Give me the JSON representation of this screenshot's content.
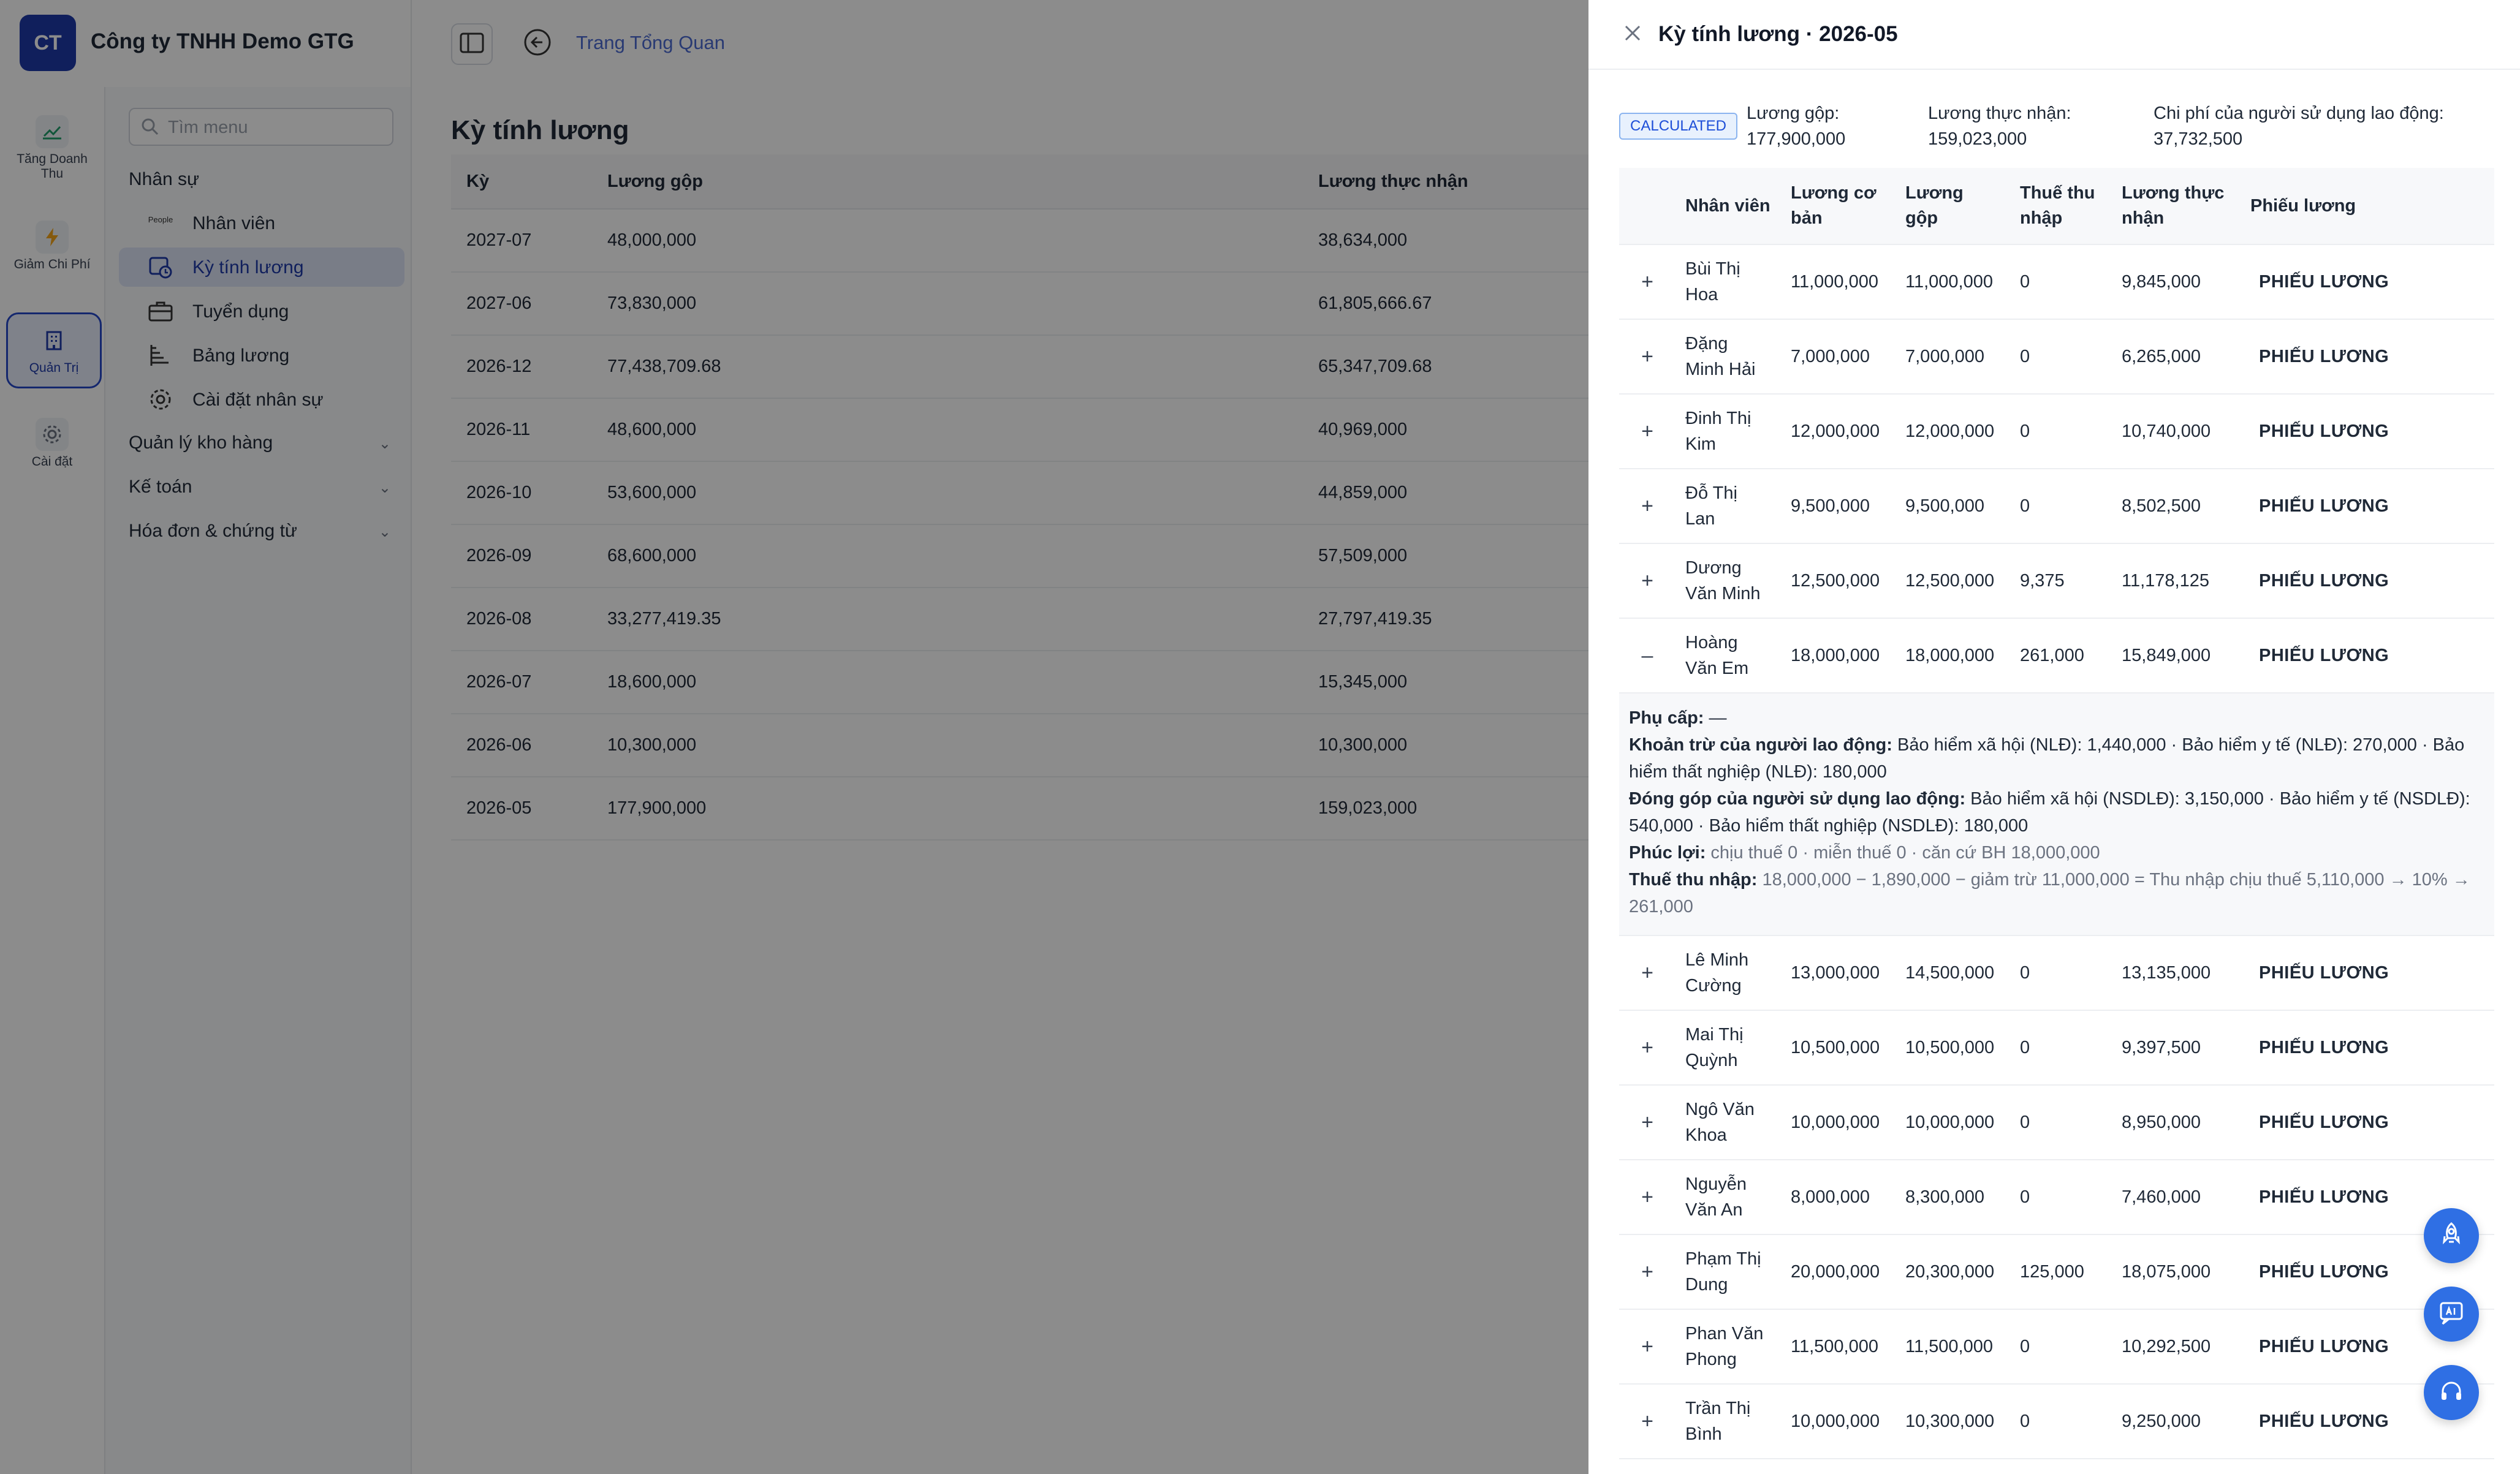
{
  "app": {
    "logo_text": "CT",
    "company_name": "Công ty TNHH Demo GTG",
    "breadcrumb": "Trang Tổng Quan"
  },
  "rail": [
    {
      "label": "Tăng Doanh Thu",
      "icon": "trending-up-icon"
    },
    {
      "label": "Giảm Chi Phí",
      "icon": "lightning-icon"
    },
    {
      "label": "Quản Trị",
      "icon": "building-icon"
    },
    {
      "label": "Cài đặt",
      "icon": "gear-icon"
    }
  ],
  "menu": {
    "search_placeholder": "Tìm menu",
    "group_hr": "Nhân sự",
    "items": [
      "Nhân viên",
      "Kỳ tính lương",
      "Tuyển dụng",
      "Bảng lương",
      "Cài đặt nhân sự"
    ],
    "people_tag": "People",
    "groups_collapsed": [
      "Quản lý kho hàng",
      "Kế toán",
      "Hóa đơn & chứng từ"
    ]
  },
  "page": {
    "title": "Kỳ tính lương",
    "columns": [
      "Kỳ",
      "Lương gộp",
      "Lương thực nhận"
    ],
    "rows": [
      [
        "2027-07",
        "48,000,000",
        "38,634,000"
      ],
      [
        "2027-06",
        "73,830,000",
        "61,805,666.67"
      ],
      [
        "2026-12",
        "77,438,709.68",
        "65,347,709.68"
      ],
      [
        "2026-11",
        "48,600,000",
        "40,969,000"
      ],
      [
        "2026-10",
        "53,600,000",
        "44,859,000"
      ],
      [
        "2026-09",
        "68,600,000",
        "57,509,000"
      ],
      [
        "2026-08",
        "33,277,419.35",
        "27,797,419.35"
      ],
      [
        "2026-07",
        "18,600,000",
        "15,345,000"
      ],
      [
        "2026-06",
        "10,300,000",
        "10,300,000"
      ],
      [
        "2026-05",
        "177,900,000",
        "159,023,000"
      ]
    ]
  },
  "drawer": {
    "title": "Kỳ tính lương · 2026-05",
    "status": "CALCULATED",
    "summary": {
      "gross_label": "Lương gộp:",
      "gross_value": "177,900,000",
      "net_label": "Lương thực nhận:",
      "net_value": "159,023,000",
      "employer_label": "Chi phí của người sử dụng lao động:",
      "employer_value": "37,732,500"
    },
    "columns": [
      "Nhân viên",
      "Lương cơ bản",
      "Lương gộp",
      "Thuế thu nhập",
      "Lương thực nhận",
      "Phiếu lương"
    ],
    "slip_label": "PHIẾU LƯƠNG",
    "rows": [
      {
        "exp": "+",
        "name": "Bùi Thị Hoa",
        "base": "11,000,000",
        "gross": "11,000,000",
        "tax": "0",
        "net": "9,845,000"
      },
      {
        "exp": "+",
        "name": "Đặng Minh Hải",
        "base": "7,000,000",
        "gross": "7,000,000",
        "tax": "0",
        "net": "6,265,000"
      },
      {
        "exp": "+",
        "name": "Đinh Thị Kim",
        "base": "12,000,000",
        "gross": "12,000,000",
        "tax": "0",
        "net": "10,740,000"
      },
      {
        "exp": "+",
        "name": "Đỗ Thị Lan",
        "base": "9,500,000",
        "gross": "9,500,000",
        "tax": "0",
        "net": "8,502,500"
      },
      {
        "exp": "+",
        "name": "Dương Văn Minh",
        "base": "12,500,000",
        "gross": "12,500,000",
        "tax": "9,375",
        "net": "11,178,125"
      },
      {
        "exp": "–",
        "name": "Hoàng Văn Em",
        "base": "18,000,000",
        "gross": "18,000,000",
        "tax": "261,000",
        "net": "15,849,000"
      },
      {
        "exp": "+",
        "name": "Lê Minh Cường",
        "base": "13,000,000",
        "gross": "14,500,000",
        "tax": "0",
        "net": "13,135,000"
      },
      {
        "exp": "+",
        "name": "Mai Thị Quỳnh",
        "base": "10,500,000",
        "gross": "10,500,000",
        "tax": "0",
        "net": "9,397,500"
      },
      {
        "exp": "+",
        "name": "Ngô Văn Khoa",
        "base": "10,000,000",
        "gross": "10,000,000",
        "tax": "0",
        "net": "8,950,000"
      },
      {
        "exp": "+",
        "name": "Nguyễn Văn An",
        "base": "8,000,000",
        "gross": "8,300,000",
        "tax": "0",
        "net": "7,460,000"
      },
      {
        "exp": "+",
        "name": "Phạm Thị Dung",
        "base": "20,000,000",
        "gross": "20,300,000",
        "tax": "125,000",
        "net": "18,075,000"
      },
      {
        "exp": "+",
        "name": "Phan Văn Phong",
        "base": "11,500,000",
        "gross": "11,500,000",
        "tax": "0",
        "net": "10,292,500"
      },
      {
        "exp": "+",
        "name": "Trần Thị Bình",
        "base": "10,000,000",
        "gross": "10,300,000",
        "tax": "0",
        "net": "9,250,000"
      }
    ],
    "detail": {
      "allowance_label": "Phụ cấp:",
      "allowance_value": "—",
      "employee_deduction_label": "Khoản trừ của người lao động:",
      "employee_deduction_value": "Bảo hiểm xã hội (NLĐ): 1,440,000 · Bảo hiểm y tế (NLĐ): 270,000 · Bảo hiểm thất nghiệp (NLĐ): 180,000",
      "employer_contribution_label": "Đóng góp của người sử dụng lao động:",
      "employer_contribution_value": "Bảo hiểm xã hội (NSDLĐ): 3,150,000 · Bảo hiểm y tế (NSDLĐ): 540,000 · Bảo hiểm thất nghiệp (NSDLĐ): 180,000",
      "benefits_label": "Phúc lợi:",
      "benefits_value": "chịu thuế 0 · miễn thuế 0 · căn cứ BH 18,000,000",
      "income_tax_label": "Thuế thu nhập:",
      "income_tax_value": "18,000,000 − 1,890,000 − giảm trừ 11,000,000 = Thu nhập chịu thuế 5,110,000 → 10% → 261,000"
    }
  },
  "fabs": [
    "rocket-icon",
    "ai-chat-icon",
    "headset-icon"
  ],
  "colors": {
    "brand": "#1e3aa8",
    "link": "#1d4ed8",
    "fab": "#2f6fe4",
    "badge_bg": "#e8f1fd"
  }
}
